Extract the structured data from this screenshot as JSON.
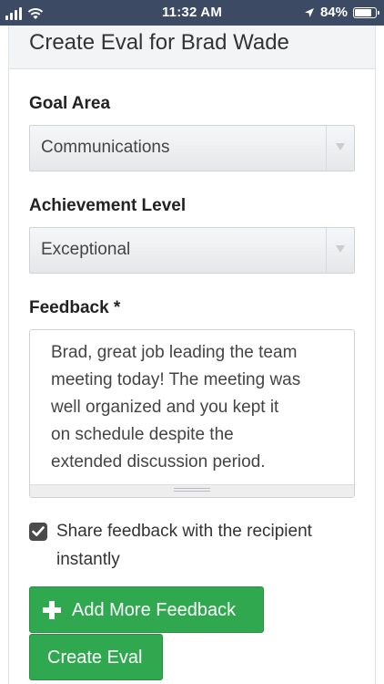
{
  "status_bar": {
    "time": "11:32 AM",
    "battery_text": "84%",
    "battery_level": 0.84,
    "icons": [
      "signal-icon",
      "wifi-icon",
      "location-icon",
      "battery-icon"
    ]
  },
  "header": {
    "title": "Create Eval for Brad Wade"
  },
  "form": {
    "goal_area": {
      "label": "Goal Area",
      "selected": "Communications"
    },
    "achievement_level": {
      "label": "Achievement Level",
      "selected": "Exceptional"
    },
    "feedback": {
      "label": "Feedback *",
      "value": "Brad, great job leading the team\nmeeting today! The meeting was\nwell organized and you kept it\non schedule despite the\nextended discussion period."
    },
    "share": {
      "checked": true,
      "label": "Share feedback with the recipient instantly"
    }
  },
  "actions": {
    "add_more_label": "Add More Feedback",
    "create_label": "Create Eval"
  },
  "colors": {
    "status_bar_bg": "#3d4a63",
    "button_green": "#2fa84f",
    "header_bg": "#f3f4f6"
  }
}
